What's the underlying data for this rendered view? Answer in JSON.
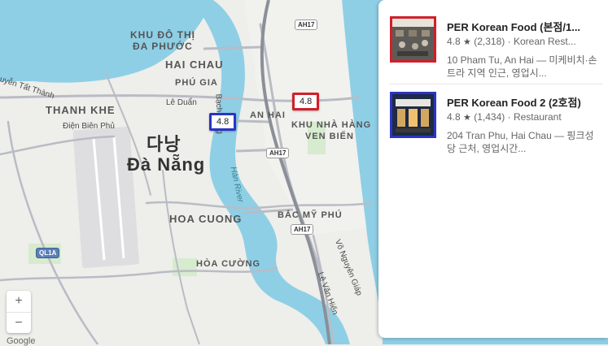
{
  "map": {
    "labels": {
      "khu_do_thi": "KHU ĐÔ THỊ",
      "da_phuoc": "ĐA PHƯỚC",
      "hai_chau": "HAI CHAU",
      "phu_gia": "PHÚ GIA",
      "thanh_khe": "THANH KHE",
      "an_hai": "AN HAI",
      "khu_nha_hang": "KHU NHÀ HÀNG",
      "ven_bien": "VEN BIỂN",
      "da_nang_kr": "다낭",
      "da_nang_vi": "Đà Nẵng",
      "hoa_cuong": "HOA CUONG",
      "hoa_cuong_vi": "HÒA CƯỜNG",
      "bac_my_phu": "BẮC MỸ PHÚ",
      "road_nguyen_tat_thanh": "uyễn Tất Thành",
      "road_le_duan": "Lê Duẩn",
      "road_dien_bien_phu": "Điện Biên Phủ",
      "road_bach_dang": "Bạch Đằng",
      "road_vo_nguyen_giap": "Võ Nguyên Giáp",
      "road_le_van_hien": "Lê Văn Hiến",
      "river": "Hàn River",
      "attribution": "Google"
    },
    "shields": {
      "ah17_top": "AH17",
      "ah17_mid": "AH17",
      "ah17_low": "AH17",
      "ql1a": "QL1A"
    },
    "markers": [
      {
        "rating": "4.8",
        "color": "#d11f2b"
      },
      {
        "rating": "4.8",
        "color": "#2b34c4"
      }
    ],
    "zoom": {
      "in": "+",
      "out": "−"
    }
  },
  "panel": {
    "cards": [
      {
        "name": "PER Korean Food (본점/1...",
        "rating": "4.8",
        "star": "★",
        "reviews": "(2,318)",
        "category": "Korean Rest...",
        "address_desc": "10 Pham Tu, An Hai — 미케비치·손트라 지역 인근, 영업시...",
        "image": "restaurant-interior-photo"
      },
      {
        "name": "PER Korean Food 2 (2호점)",
        "rating": "4.8",
        "star": "★",
        "reviews": "(1,434)",
        "category": "Restaurant",
        "address_desc": "204 Tran Phu, Hai Chau — 핑크성당 근처, 영업시간...",
        "image": "restaurant-storefront-photo"
      }
    ],
    "separator": "·"
  }
}
